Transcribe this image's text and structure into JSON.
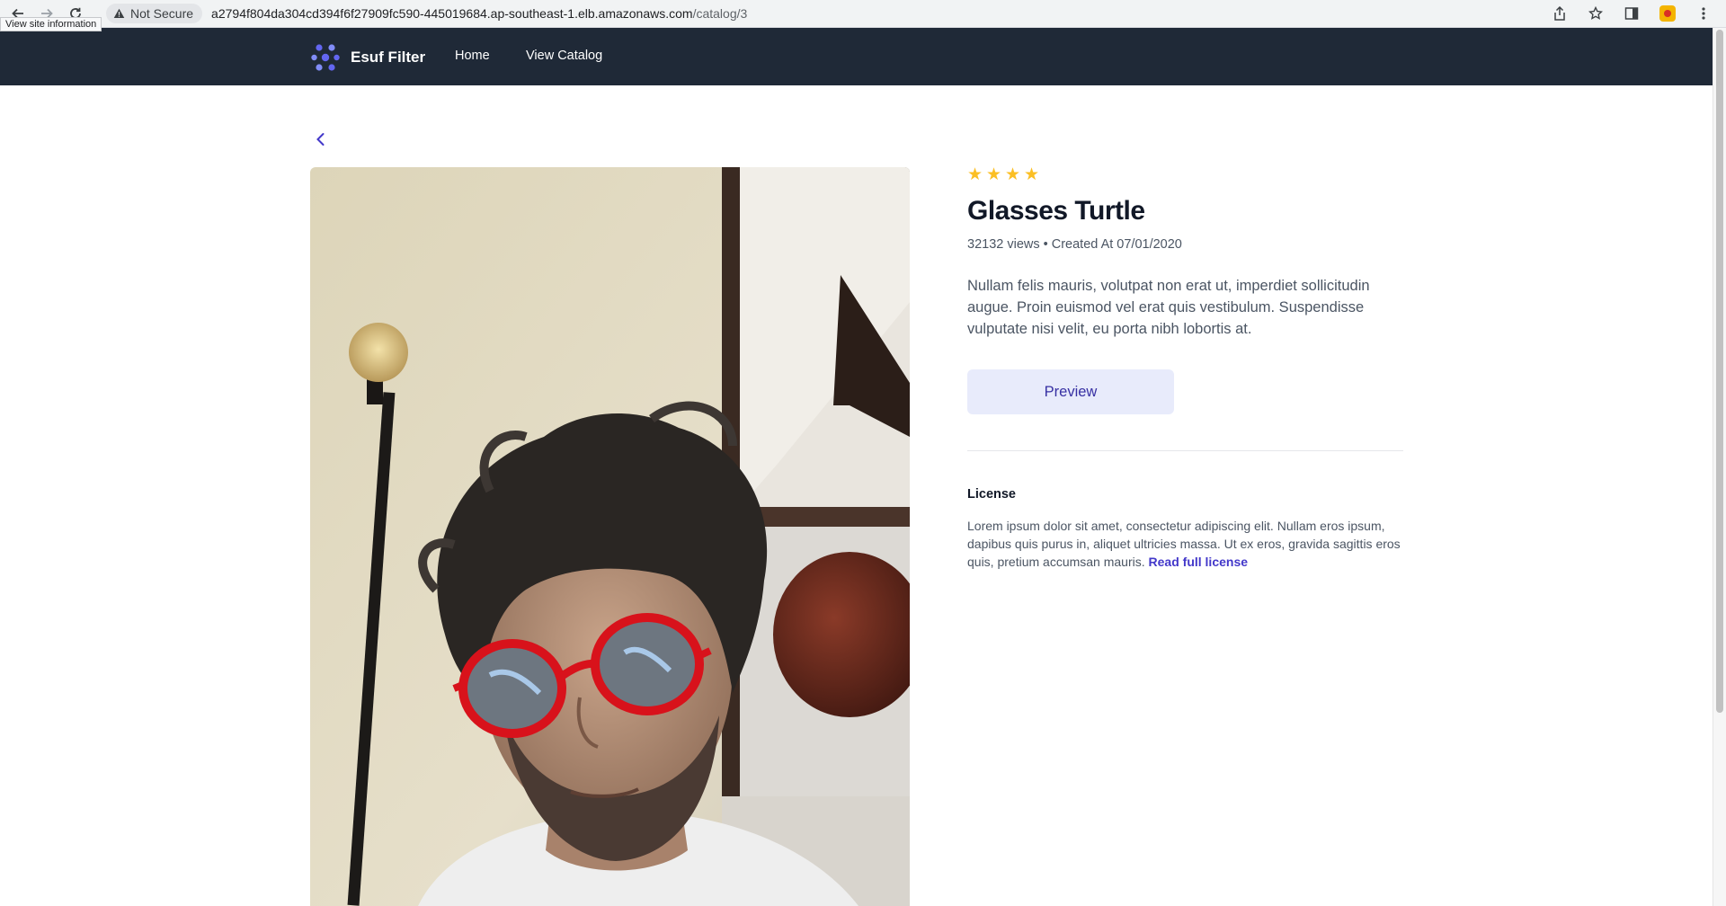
{
  "browser": {
    "security_label": "Not Secure",
    "url_host": "a2794f804da304cd394f6f27909fc590-445019684.ap-southeast-1.elb.amazonaws.com",
    "url_path": "/catalog/3",
    "tooltip": "View site information"
  },
  "nav": {
    "brand": "Esuf Filter",
    "links": [
      "Home",
      "View Catalog"
    ],
    "brand_color": "#6366f1",
    "background": "#1f2937"
  },
  "product": {
    "rating": 4,
    "rating_max": 4,
    "title": "Glasses Turtle",
    "views": "32132 views",
    "created": "Created At 07/01/2020",
    "description": "Nullam felis mauris, volutpat non erat ut, imperdiet sollicitudin augue. Proin euismod vel erat quis vestibulum. Suspendisse vulputate nisi velit, eu porta nibh lobortis at.",
    "preview_label": "Preview"
  },
  "license": {
    "heading": "License",
    "text": "Lorem ipsum dolor sit amet, consectetur adipiscing elit. Nullam eros ipsum, dapibus quis purus in, aliquet ultricies massa. Ut ex eros, gravida sagittis eros quis, pretium accumsan mauris.",
    "link": "Read full license"
  },
  "colors": {
    "accent": "#4338ca",
    "star": "#fbbf24"
  }
}
